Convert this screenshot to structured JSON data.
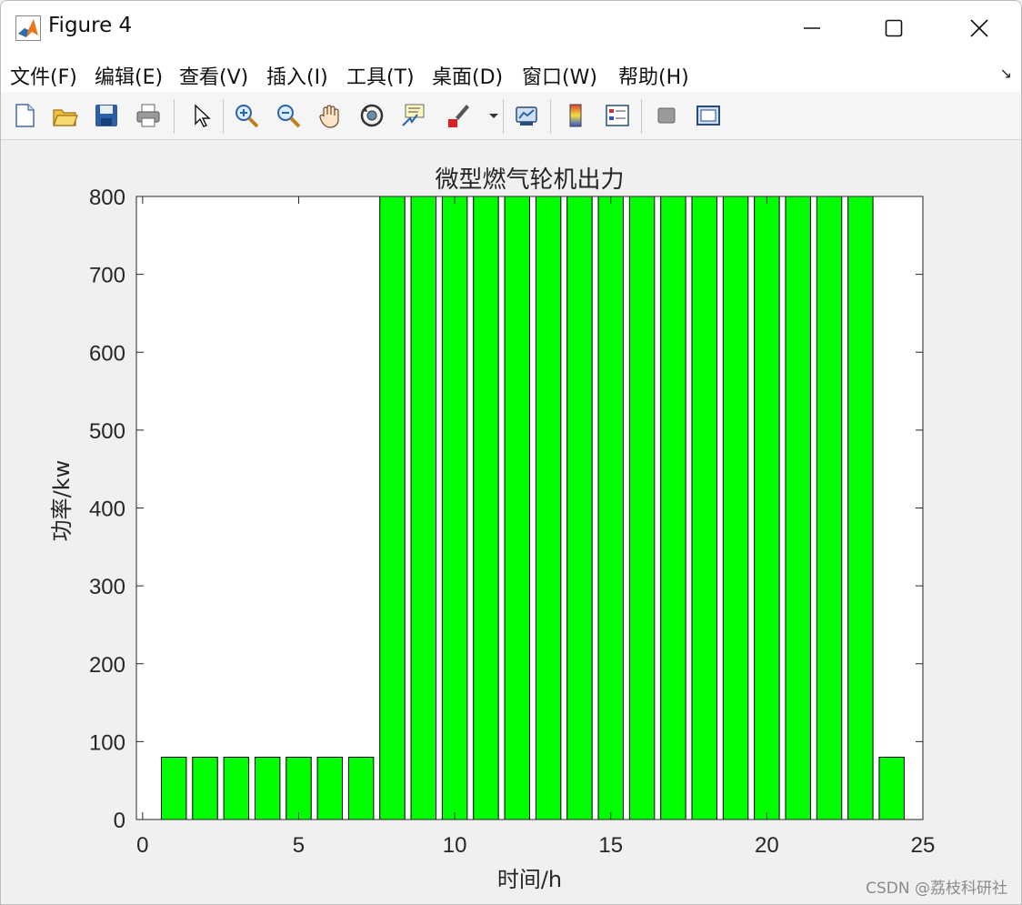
{
  "window": {
    "title": "Figure 4"
  },
  "menu": {
    "items": [
      "文件(F)",
      "编辑(E)",
      "查看(V)",
      "插入(I)",
      "工具(T)",
      "桌面(D)",
      "窗口(W)",
      "帮助(H)"
    ]
  },
  "toolbar": {
    "icons": [
      "new-file-icon",
      "open-folder-icon",
      "save-icon",
      "print-icon",
      "select-arrow-icon",
      "zoom-in-icon",
      "zoom-out-icon",
      "pan-hand-icon",
      "rotate-3d-icon",
      "data-cursor-icon",
      "brush-icon",
      "link-plot-icon",
      "colorbar-icon",
      "legend-icon",
      "hide-plot-tools-icon",
      "show-plot-tools-icon"
    ]
  },
  "colors": {
    "bar": "#00ff00",
    "bar_edge": "#000000"
  },
  "chart_data": {
    "type": "bar",
    "title": "微型燃气轮机出力",
    "xlabel": "时间/h",
    "ylabel": "功率/kw",
    "x": [
      1,
      2,
      3,
      4,
      5,
      6,
      7,
      8,
      9,
      10,
      11,
      12,
      13,
      14,
      15,
      16,
      17,
      18,
      19,
      20,
      21,
      22,
      23,
      24
    ],
    "values": [
      80,
      80,
      80,
      80,
      80,
      80,
      80,
      800,
      800,
      800,
      800,
      800,
      800,
      800,
      800,
      800,
      800,
      800,
      800,
      800,
      800,
      800,
      800,
      80
    ],
    "xlim": [
      -0.2,
      25
    ],
    "ylim": [
      0,
      800
    ],
    "xticks": [
      0,
      5,
      10,
      15,
      20,
      25
    ],
    "yticks": [
      0,
      100,
      200,
      300,
      400,
      500,
      600,
      700,
      800
    ],
    "grid": false,
    "legend": "none"
  },
  "watermark": "CSDN @荔枝科研社"
}
